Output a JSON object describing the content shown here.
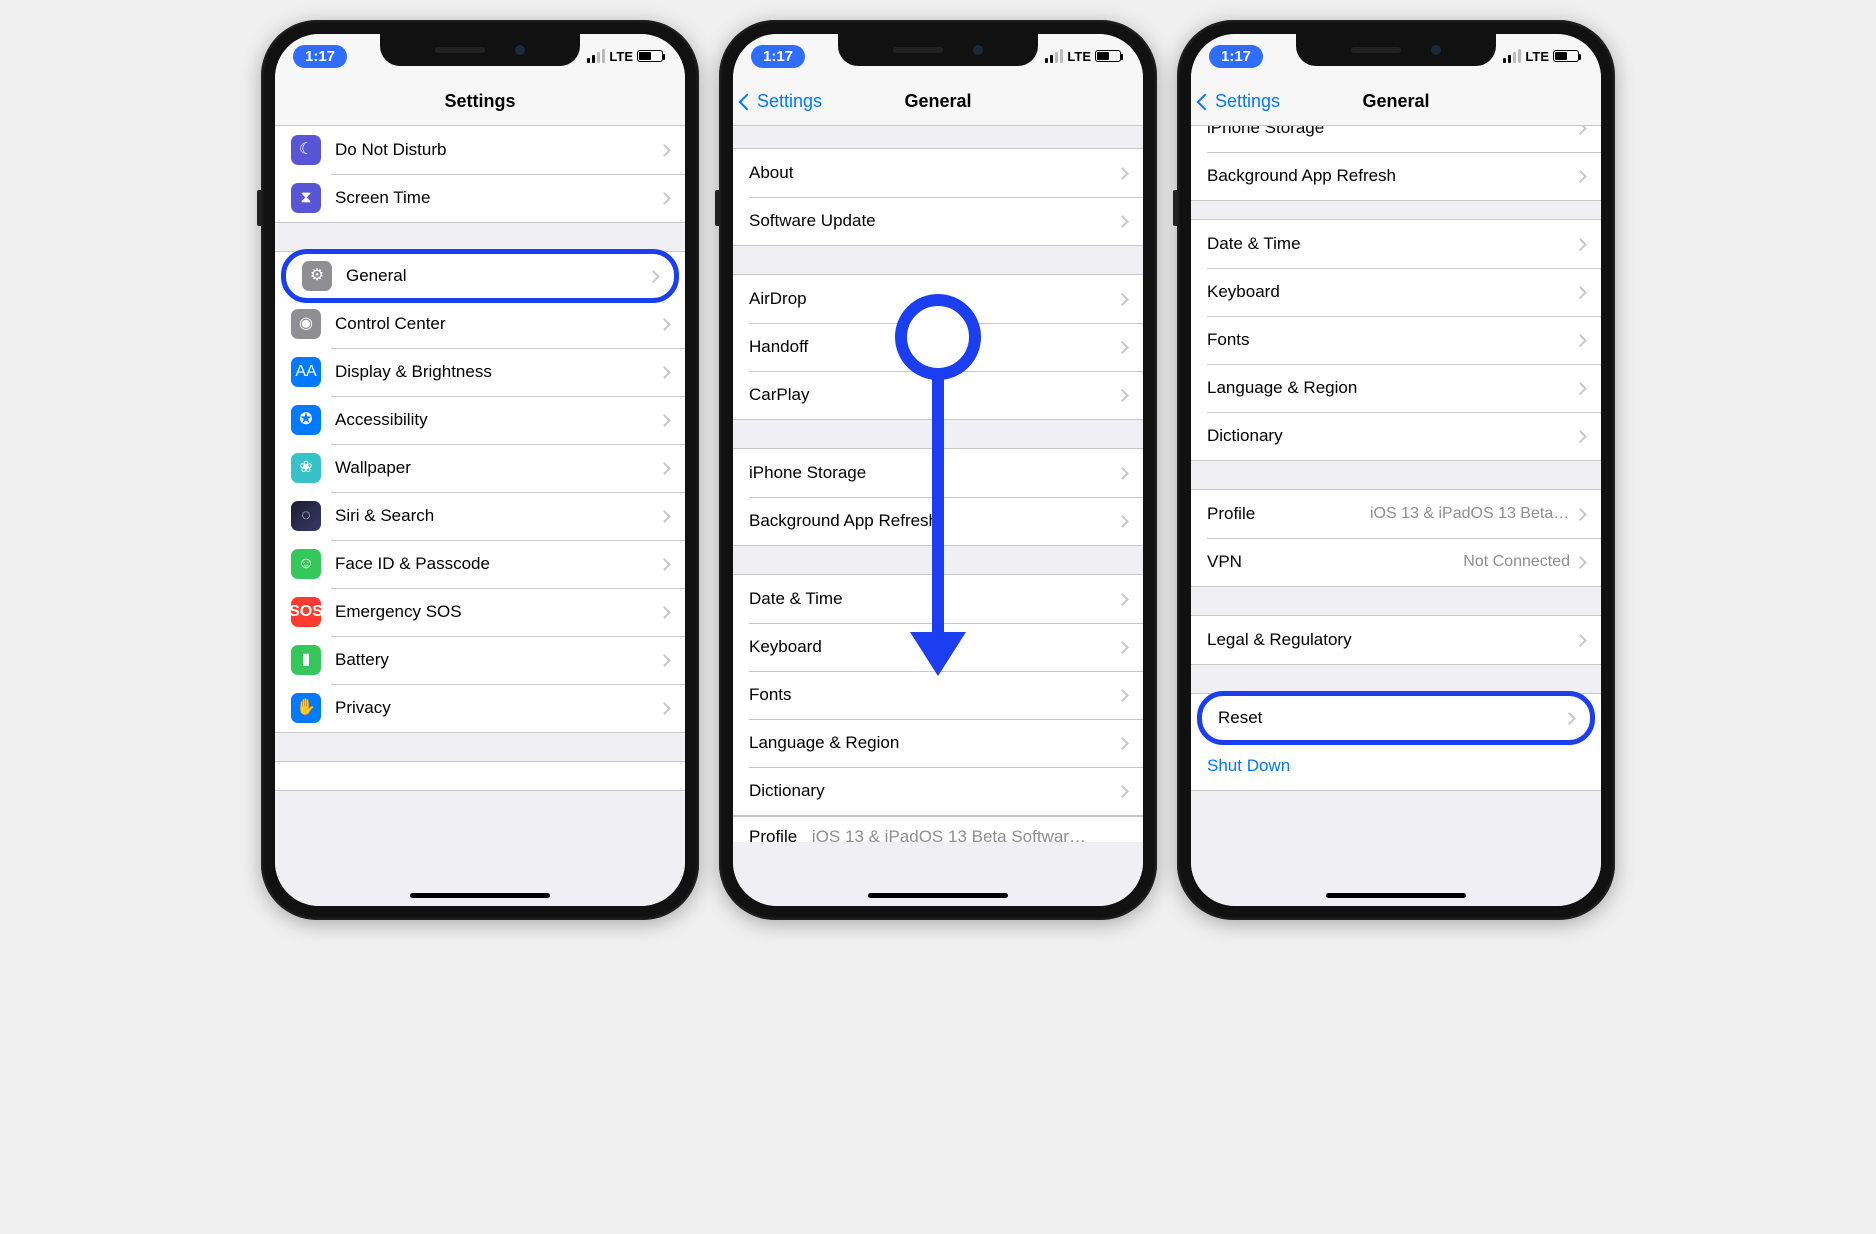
{
  "status": {
    "time": "1:17",
    "network": "LTE"
  },
  "phone1": {
    "title": "Settings",
    "group_top": [
      {
        "label": "Do Not Disturb",
        "iconClass": "ic-dnd",
        "iconGlyph": "☾",
        "name": "row-do-not-disturb"
      },
      {
        "label": "Screen Time",
        "iconClass": "ic-screentime",
        "iconGlyph": "⧗",
        "name": "row-screen-time"
      }
    ],
    "highlighted": {
      "label": "General",
      "iconClass": "ic-general",
      "iconGlyph": "⚙",
      "name": "row-general"
    },
    "group_main_rest": [
      {
        "label": "Control Center",
        "iconClass": "ic-cc",
        "iconGlyph": "◉",
        "name": "row-control-center"
      },
      {
        "label": "Display & Brightness",
        "iconClass": "ic-display",
        "iconGlyph": "AA",
        "name": "row-display-brightness"
      },
      {
        "label": "Accessibility",
        "iconClass": "ic-access",
        "iconGlyph": "✪",
        "name": "row-accessibility"
      },
      {
        "label": "Wallpaper",
        "iconClass": "ic-wall",
        "iconGlyph": "❀",
        "name": "row-wallpaper"
      },
      {
        "label": "Siri & Search",
        "iconClass": "ic-siri",
        "iconGlyph": "◌",
        "name": "row-siri-search"
      },
      {
        "label": "Face ID & Passcode",
        "iconClass": "ic-faceid",
        "iconGlyph": "☺",
        "name": "row-faceid-passcode"
      },
      {
        "label": "Emergency SOS",
        "iconClass": "ic-sos",
        "iconGlyph": "SOS",
        "name": "row-emergency-sos"
      },
      {
        "label": "Battery",
        "iconClass": "ic-battery",
        "iconGlyph": "▮",
        "name": "row-battery"
      },
      {
        "label": "Privacy",
        "iconClass": "ic-privacy",
        "iconGlyph": "✋",
        "name": "row-privacy"
      }
    ]
  },
  "phone2": {
    "back": "Settings",
    "title": "General",
    "g1": [
      {
        "label": "About",
        "name": "row-about"
      },
      {
        "label": "Software Update",
        "name": "row-software-update"
      }
    ],
    "g2": [
      {
        "label": "AirDrop",
        "name": "row-airdrop"
      },
      {
        "label": "Handoff",
        "name": "row-handoff"
      },
      {
        "label": "CarPlay",
        "name": "row-carplay"
      }
    ],
    "g3": [
      {
        "label": "iPhone Storage",
        "name": "row-iphone-storage"
      },
      {
        "label": "Background App Refresh",
        "name": "row-background-app-refresh"
      }
    ],
    "g4": [
      {
        "label": "Date & Time",
        "name": "row-date-time"
      },
      {
        "label": "Keyboard",
        "name": "row-keyboard"
      },
      {
        "label": "Fonts",
        "name": "row-fonts"
      },
      {
        "label": "Language & Region",
        "name": "row-language-region"
      },
      {
        "label": "Dictionary",
        "name": "row-dictionary"
      }
    ],
    "peek": {
      "label": "Profile",
      "detail": "iOS 13 & iPadOS 13 Beta Softwar…"
    }
  },
  "phone3": {
    "back": "Settings",
    "title": "General",
    "g_top_partial": [
      {
        "label": "iPhone Storage",
        "name": "row-iphone-storage"
      },
      {
        "label": "Background App Refresh",
        "name": "row-background-app-refresh"
      }
    ],
    "g_mid": [
      {
        "label": "Date & Time",
        "name": "row-date-time"
      },
      {
        "label": "Keyboard",
        "name": "row-keyboard"
      },
      {
        "label": "Fonts",
        "name": "row-fonts"
      },
      {
        "label": "Language & Region",
        "name": "row-language-region"
      },
      {
        "label": "Dictionary",
        "name": "row-dictionary"
      }
    ],
    "g_profile": [
      {
        "label": "Profile",
        "detail": "iOS 13 & iPadOS 13 Beta Softwar...",
        "name": "row-profile"
      },
      {
        "label": "VPN",
        "detail": "Not Connected",
        "name": "row-vpn"
      }
    ],
    "g_legal": [
      {
        "label": "Legal & Regulatory",
        "name": "row-legal-regulatory"
      }
    ],
    "g_reset": {
      "highlighted": {
        "label": "Reset",
        "name": "row-reset"
      },
      "link": {
        "label": "Shut Down",
        "name": "row-shut-down"
      }
    }
  }
}
